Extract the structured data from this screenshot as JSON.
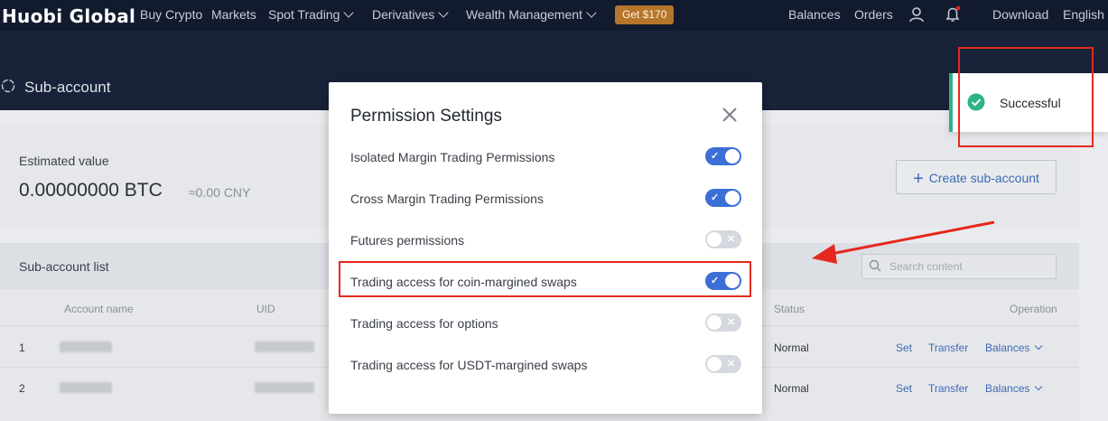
{
  "brand": {
    "logo_a": "Huo",
    "logo_b": "bi",
    "logo_c": " Global"
  },
  "topnav": {
    "items": [
      "Buy Crypto",
      "Markets",
      "Spot Trading",
      "Derivatives",
      "Wealth Management"
    ],
    "promo": "Get $170",
    "right": [
      "Balances",
      "Orders",
      "Download",
      "English"
    ]
  },
  "subheader": {
    "title": "Sub-account"
  },
  "overview": {
    "label": "Estimated value",
    "value": "0.00000000 BTC",
    "cny": "≈0.00 CNY",
    "create_button": "Create sub-account"
  },
  "list": {
    "title": "Sub-account list",
    "search_placeholder": "Search content",
    "columns": [
      "Account name",
      "UID",
      "Status",
      "Operation"
    ],
    "rows": [
      {
        "index": "1",
        "status": "Normal",
        "actions": [
          "Set",
          "Transfer",
          "Balances"
        ]
      },
      {
        "index": "2",
        "status": "Normal",
        "actions": [
          "Set",
          "Transfer",
          "Balances"
        ]
      }
    ]
  },
  "modal": {
    "title": "Permission Settings",
    "permissions": [
      {
        "label": "Isolated Margin Trading Permissions",
        "enabled": true
      },
      {
        "label": "Cross Margin Trading Permissions",
        "enabled": true
      },
      {
        "label": "Futures permissions",
        "enabled": false
      },
      {
        "label": "Trading access for coin-margined swaps",
        "enabled": true
      },
      {
        "label": "Trading access for options",
        "enabled": false
      },
      {
        "label": "Trading access for USDT-margined swaps",
        "enabled": false
      }
    ]
  },
  "toast": {
    "text": "Successful",
    "icon": "check-circle-icon",
    "accent": "#2bb38a"
  },
  "annotation_color": "#e5291e"
}
